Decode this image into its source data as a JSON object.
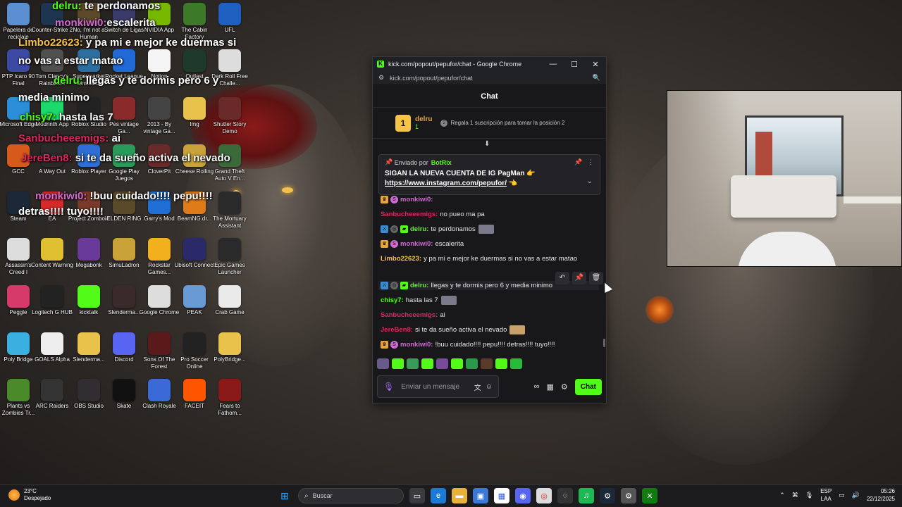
{
  "desktop_icons": [
    {
      "label": "Papelera de reciclaje",
      "icon": "recycle-bin-icon",
      "color": "#5b8fd1"
    },
    {
      "label": "Counter-Strike 2",
      "icon": "cs2-icon",
      "color": "#1e3550"
    },
    {
      "label": "No, I'm not a Human",
      "icon": "game-icon",
      "color": "#5d4a2a"
    },
    {
      "label": "Switch de Ligas",
      "icon": "football-icon",
      "color": "#3b3b6b"
    },
    {
      "label": "NVIDIA App",
      "icon": "nvidia-icon",
      "color": "#76b900"
    },
    {
      "label": "The Cabin Factory",
      "icon": "frog-icon",
      "color": "#3c7a2a"
    },
    {
      "label": "UFL",
      "icon": "ufl-icon",
      "color": "#1f5fbf"
    },
    {
      "label": "PTP Icaro 90 Final",
      "icon": "app-icon",
      "color": "#3d4aa3"
    },
    {
      "label": "Tom Clancy's Rainbow...",
      "icon": "game-icon",
      "color": "#505050"
    },
    {
      "label": "Supermarket Simulator",
      "icon": "game-icon",
      "color": "#2e6e9e"
    },
    {
      "label": "Rocket League",
      "icon": "rocket-league-icon",
      "color": "#2169d6"
    },
    {
      "label": "Notion",
      "icon": "notion-icon",
      "color": "#f5f5f5"
    },
    {
      "label": "Outlast",
      "icon": "game-icon",
      "color": "#1e3a2a"
    },
    {
      "label": "Dark Roll Free Challe...",
      "icon": "ball-icon",
      "color": "#dddddd"
    },
    {
      "label": "Microsoft Edge",
      "icon": "edge-icon",
      "color": "#2a8ed8"
    },
    {
      "label": "Modrinth App",
      "icon": "modrinth-icon",
      "color": "#1bd96a"
    },
    {
      "label": "Roblox Studio",
      "icon": "roblox-studio-icon",
      "color": "#222222"
    },
    {
      "label": "Pes vintage Ga...",
      "icon": "game-icon",
      "color": "#8a2a2a"
    },
    {
      "label": "2013 - By vintage Ga...",
      "icon": "game-icon",
      "color": "#444444"
    },
    {
      "label": "Img",
      "icon": "folder-icon",
      "color": "#e8c24a"
    },
    {
      "label": "Shutter Story Demo",
      "icon": "game-icon",
      "color": "#6b2a2a"
    },
    {
      "label": "GCC",
      "icon": "app-icon",
      "color": "#d65a1a"
    },
    {
      "label": "A Way Out",
      "icon": "game-icon",
      "color": "#2a2a2a"
    },
    {
      "label": "Roblox Player",
      "icon": "roblox-icon",
      "color": "#2e6fd6"
    },
    {
      "label": "Google Play Juegos",
      "icon": "google-play-icon",
      "color": "#2a9a5a"
    },
    {
      "label": "CloverPit",
      "icon": "game-icon",
      "color": "#6a2a2a"
    },
    {
      "label": "Cheese Rolling",
      "icon": "game-icon",
      "color": "#c9a23a"
    },
    {
      "label": "Grand Theft Auto V En...",
      "icon": "gta-icon",
      "color": "#3a6a3a"
    },
    {
      "label": "Steam",
      "icon": "steam-icon",
      "color": "#1b2838"
    },
    {
      "label": "EA",
      "icon": "ea-icon",
      "color": "#d62a2a"
    },
    {
      "label": "Project Zomboid",
      "icon": "game-icon",
      "color": "#7a3a2a"
    },
    {
      "label": "ELDEN RING",
      "icon": "game-icon",
      "color": "#5a4a2a"
    },
    {
      "label": "Garry's Mod",
      "icon": "gmod-icon",
      "color": "#1f6fd6"
    },
    {
      "label": "BeamNG.dr...",
      "icon": "beamng-icon",
      "color": "#e07b1a"
    },
    {
      "label": "The Mortuary Assistant",
      "icon": "game-icon",
      "color": "#2a2a2a"
    },
    {
      "label": "Assassin's Creed I",
      "icon": "game-icon",
      "color": "#dddddd"
    },
    {
      "label": "Content Warning",
      "icon": "game-icon",
      "color": "#e0c030"
    },
    {
      "label": "Megabonk",
      "icon": "game-icon",
      "color": "#6a3a9a"
    },
    {
      "label": "SimuLadron",
      "icon": "game-icon",
      "color": "#c9a23a"
    },
    {
      "label": "Rockstar Games...",
      "icon": "rockstar-icon",
      "color": "#f2b01e"
    },
    {
      "label": "Ubisoft Connect",
      "icon": "ubisoft-icon",
      "color": "#2a2a6a"
    },
    {
      "label": "Epic Games Launcher",
      "icon": "epic-icon",
      "color": "#2a2a2a"
    },
    {
      "label": "Peggle",
      "icon": "game-icon",
      "color": "#d63a6a"
    },
    {
      "label": "Logitech G HUB",
      "icon": "logitech-icon",
      "color": "#222222"
    },
    {
      "label": "kicktalk",
      "icon": "kick-icon",
      "color": "#53fc18"
    },
    {
      "label": "Slenderma...",
      "icon": "game-icon",
      "color": "#3a2a2a"
    },
    {
      "label": "Google Chrome",
      "icon": "chrome-icon",
      "color": "#dddddd"
    },
    {
      "label": "PEAK",
      "icon": "game-icon",
      "color": "#6a9ad6"
    },
    {
      "label": "Crab Game",
      "icon": "game-icon",
      "color": "#eaeaea"
    },
    {
      "label": "Poly Bridge",
      "icon": "game-icon",
      "color": "#3ab0e0"
    },
    {
      "label": "GOALS Alpha",
      "icon": "game-icon",
      "color": "#eeeeee"
    },
    {
      "label": "Slenderma...",
      "icon": "folder-icon",
      "color": "#e8c24a"
    },
    {
      "label": "Discord",
      "icon": "discord-icon",
      "color": "#5865f2"
    },
    {
      "label": "Sons Of The Forest",
      "icon": "game-icon",
      "color": "#5a1a1a"
    },
    {
      "label": "Pro Soccer Online",
      "icon": "ball-icon",
      "color": "#222222"
    },
    {
      "label": "PolyBridge...",
      "icon": "folder-icon",
      "color": "#e8c24a"
    },
    {
      "label": "Plants vs Zombies Tr...",
      "icon": "game-icon",
      "color": "#4a8a2a"
    },
    {
      "label": "ARC Raiders",
      "icon": "game-icon",
      "color": "#333333"
    },
    {
      "label": "OBS Studio",
      "icon": "obs-icon",
      "color": "#302e31"
    },
    {
      "label": "Skate",
      "icon": "game-icon",
      "color": "#111111"
    },
    {
      "label": "Clash Royale",
      "icon": "game-icon",
      "color": "#3a6ad6"
    },
    {
      "label": "FACEIT",
      "icon": "faceit-icon",
      "color": "#ff5500"
    },
    {
      "label": "Fears to Fathom...",
      "icon": "game-icon",
      "color": "#8a1a1a"
    }
  ],
  "overlay_chat": [
    {
      "user": "delru:",
      "text": " te perdonamos",
      "user_color": "#53fc18"
    },
    {
      "user": "monkiwi0:",
      "text": "escalerita",
      "user_color": "#d06bd2"
    },
    {
      "user": "Limbo22623:",
      "text": " y pa mi e mejor ke duermas si",
      "user_color": "#f6c343"
    },
    {
      "user": "",
      "text": "no vas a estar matao",
      "user_color": "#ffffff"
    },
    {
      "user": "delru:",
      "text": " llegas y te dormis pero 6 y",
      "user_color": "#53fc18"
    },
    {
      "user": "",
      "text": "media minimo",
      "user_color": "#ffffff"
    },
    {
      "user": "chisy7:",
      "text": " hasta las 7",
      "user_color": "#53fc18"
    },
    {
      "user": "Sanbucheeemigs:",
      "text": " ai",
      "user_color": "#e0245e"
    },
    {
      "user": "JereBen8:",
      "text": " si te da sueño activa el nevado",
      "user_color": "#e0245e"
    },
    {
      "user": "monkiwi0:",
      "text": " !buu cuidado!!!! pepu!!!!",
      "user_color": "#d06bd2"
    },
    {
      "user": "",
      "text": "detras!!!! tuyo!!!!",
      "user_color": "#ffffff"
    }
  ],
  "browser": {
    "title": "kick.com/popout/pepufor/chat - Google Chrome",
    "url": "kick.com/popout/pepufor/chat",
    "favicon": "K"
  },
  "chat": {
    "header": "Chat",
    "gift": {
      "rank": "1",
      "user": "delru",
      "count": "1",
      "message": "Regala 1 suscripción para tomar la posición 2"
    },
    "pinned": {
      "label": "Enviado por",
      "bot": "BotRix",
      "line1": "SIGAN LA NUEVA CUENTA DE IG PagMan 👉",
      "link": "https://www.instagram.com/pepufor/",
      "link_suffix": " 👈"
    },
    "messages": [
      {
        "user": "monkiwi0:",
        "text": "",
        "color": "#d06bd2",
        "badges": [
          "crown",
          "sub"
        ]
      },
      {
        "user": "Sanbucheeemigs:",
        "text": "no pueo ma pa",
        "color": "#e0245e",
        "badges": []
      },
      {
        "user": "delru:",
        "text": "te perdonamos",
        "color": "#53fc18",
        "badges": [
          "mod",
          "vip",
          "green"
        ]
      },
      {
        "user": "monkiwi0:",
        "text": "escalerita",
        "color": "#d06bd2",
        "badges": [
          "crown",
          "sub"
        ]
      },
      {
        "user": "Limbo22623:",
        "text": "y pa mi e mejor ke duermas si no vas a estar matao",
        "color": "#f6c343",
        "badges": []
      },
      {
        "user": "delru:",
        "text": "llegas y te dormis pero 6 y media minimo",
        "color": "#53fc18",
        "badges": [
          "mod",
          "vip",
          "green"
        ]
      },
      {
        "user": "chisy7:",
        "text": "hasta las 7",
        "color": "#53fc18",
        "badges": []
      },
      {
        "user": "Sanbucheeemigs:",
        "text": "ai",
        "color": "#e0245e",
        "badges": []
      },
      {
        "user": "JereBen8:",
        "text": "si te da sueño activa el nevado",
        "color": "#e0245e",
        "badges": []
      },
      {
        "user": "monkiwi0:",
        "text": "!buu cuidado!!!! pepu!!!! detras!!!! tuyo!!!!",
        "color": "#d06bd2",
        "badges": [
          "crown",
          "sub"
        ]
      }
    ],
    "input_placeholder": "Enviar un mensaje",
    "send_label": "Chat"
  },
  "taskbar": {
    "weather_temp": "23°C",
    "weather_desc": "Despejado",
    "search_placeholder": "Buscar",
    "lang_line1": "ESP",
    "lang_line2": "LAA",
    "time": "05:26",
    "date": "22/12/2025"
  },
  "colors": {
    "kick_green": "#53fc18",
    "chat_bg": "#18181b"
  }
}
